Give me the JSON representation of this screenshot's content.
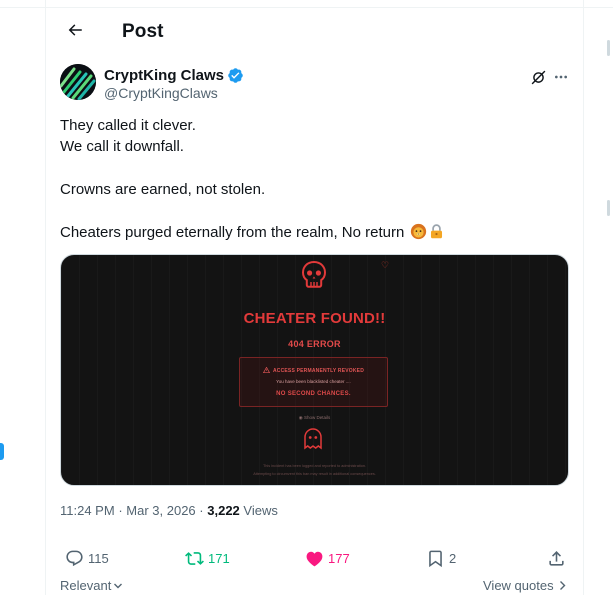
{
  "header": {
    "title": "Post"
  },
  "author": {
    "display_name": "CryptKing Claws",
    "handle": "@CryptKingClaws",
    "verified": true
  },
  "tweet": {
    "lines": [
      "They called it clever.",
      "We call it downfall.",
      "Crowns are earned, not stolen.",
      "Cheaters purged eternally from the realm, No return"
    ],
    "emojis": [
      "lion-face-emoji",
      "locked-emoji"
    ]
  },
  "media": {
    "title": "CHEATER FOUND!!",
    "error_code": "404 ERROR",
    "box_heading": "ACCESS PERMANENTLY REVOKED",
    "box_body": "You have been blacklisted cheater ....",
    "box_strong": "NO SECOND CHANCES.",
    "show_details": "Show Details",
    "footer_line_1": "This incident has been logged and reported to administration.",
    "footer_line_2": "Attempting to circumvent this ban may result in additional consequences."
  },
  "meta": {
    "time": "11:24 PM",
    "date": "Mar 3, 2026",
    "views_count": "3,222",
    "views_label": "Views",
    "separator": "·"
  },
  "actions": {
    "replies": "115",
    "reposts": "171",
    "likes": "177",
    "bookmarks": "2"
  },
  "footer": {
    "relevant_label": "Relevant",
    "view_quotes_label": "View quotes"
  },
  "colors": {
    "text": "#0f1419",
    "muted": "#536471",
    "verified": "#1d9bf0",
    "repost": "#00ba7c",
    "like": "#f91880",
    "media_bg": "#131313",
    "media_accent": "#e23a3a"
  }
}
